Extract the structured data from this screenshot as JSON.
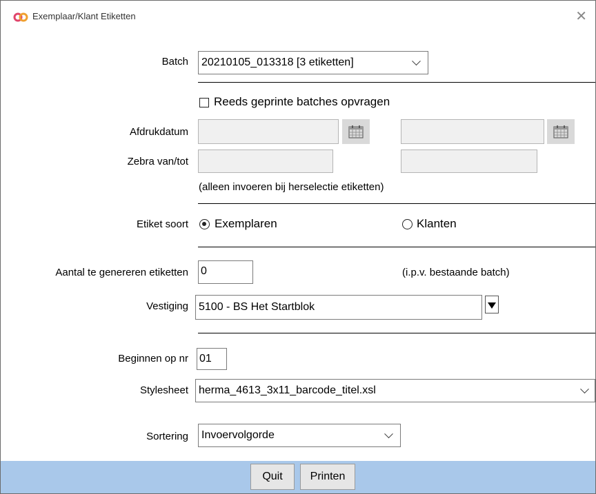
{
  "window": {
    "title": "Exemplaar/Klant Etiketten",
    "close_glyph": "✕"
  },
  "batch": {
    "label": "Batch",
    "value": "20210105_013318 [3 etiketten]"
  },
  "reprint": {
    "label": "Reeds geprinte batches opvragen",
    "checked": false
  },
  "print_date": {
    "label": "Afdrukdatum",
    "from": "",
    "to": ""
  },
  "zebra": {
    "label": "Zebra van/tot",
    "from": "",
    "to": ""
  },
  "hint": "(alleen invoeren bij herselectie etiketten)",
  "label_type": {
    "label": "Etiket soort",
    "options": [
      "Exemplaren",
      "Klanten"
    ],
    "selected": "Exemplaren"
  },
  "count": {
    "label": "Aantal te genereren etiketten",
    "value": "0",
    "note": "(i.p.v. bestaande batch)"
  },
  "branch": {
    "label": "Vestiging",
    "value": "5100 - BS Het Startblok"
  },
  "start": {
    "label": "Beginnen op nr",
    "value": "01"
  },
  "stylesheet": {
    "label": "Stylesheet",
    "value": "herma_4613_3x11_barcode_titel.xsl"
  },
  "sorting": {
    "label": "Sortering",
    "value": "Invoervolgorde"
  },
  "buttons": {
    "quit": "Quit",
    "print": "Printen"
  },
  "colors": {
    "footer": "#a9c8ea",
    "logo": "#e0456b"
  }
}
